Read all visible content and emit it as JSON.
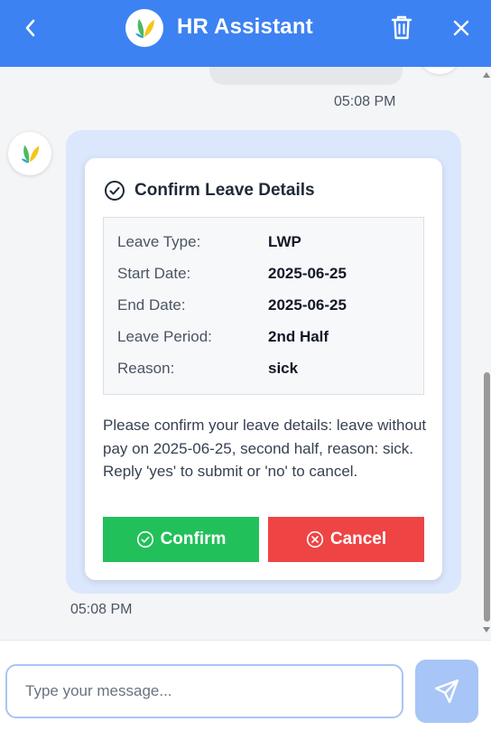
{
  "header": {
    "title": "HR Assistant",
    "icons": {
      "back": "chevron-left-icon",
      "delete": "trash-icon",
      "close": "close-icon",
      "logo": "leaf-logo-icon"
    }
  },
  "chat": {
    "previous_time": "05:08 PM",
    "confirm_card": {
      "title": "Confirm Leave Details",
      "details": [
        {
          "label": "Leave Type:",
          "value": "LWP"
        },
        {
          "label": "Start Date:",
          "value": "2025-06-25"
        },
        {
          "label": "End Date:",
          "value": "2025-06-25"
        },
        {
          "label": "Leave Period:",
          "value": "2nd Half"
        },
        {
          "label": "Reason:",
          "value": "sick"
        }
      ],
      "message": "Please confirm your leave details: leave without pay on 2025-06-25, second half, reason: sick. Reply 'yes' to submit or 'no' to cancel.",
      "confirm_label": "Confirm",
      "cancel_label": "Cancel"
    },
    "bot_time": "05:08 PM"
  },
  "composer": {
    "placeholder": "Type your message...",
    "value": ""
  },
  "colors": {
    "header": "#3d82f2",
    "bubble": "#dbe7fc",
    "confirm": "#22c05a",
    "cancel": "#ef4444",
    "send": "#a7c5f6"
  }
}
